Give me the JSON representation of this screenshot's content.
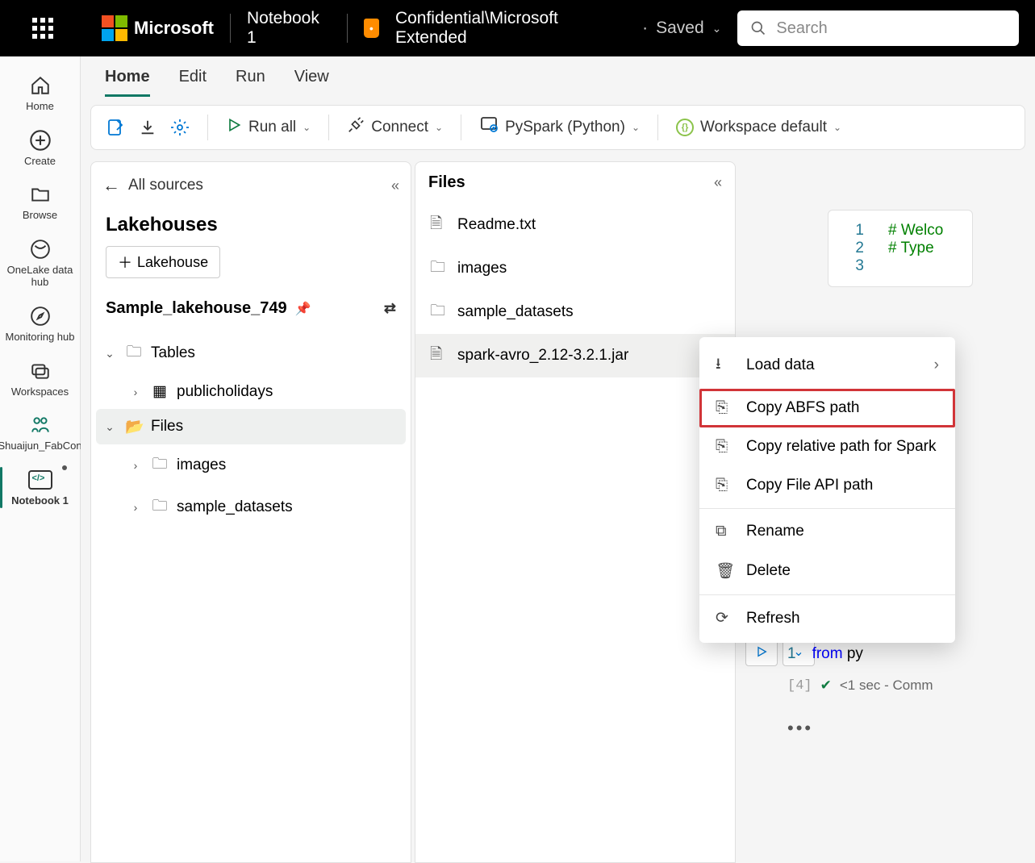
{
  "topbar": {
    "brand": "Microsoft",
    "notebook": "Notebook 1",
    "confidential": "Confidential\\Microsoft Extended",
    "saved": "Saved"
  },
  "search": {
    "placeholder": "Search"
  },
  "rail": {
    "home": "Home",
    "create": "Create",
    "browse": "Browse",
    "datahub": "OneLake data hub",
    "monitor": "Monitoring hub",
    "workspaces": "Workspaces",
    "ws_name": "Shuaijun_FabCon",
    "nb": "Notebook 1"
  },
  "tabs": {
    "home": "Home",
    "edit": "Edit",
    "run": "Run",
    "view": "View"
  },
  "toolbar": {
    "run_all": "Run all",
    "connect": "Connect",
    "language": "PySpark (Python)",
    "env": "Workspace default"
  },
  "panel1": {
    "all_sources": "All sources",
    "title": "Lakehouses",
    "add_btn": "Lakehouse",
    "lakehouse": "Sample_lakehouse_749",
    "tables": "Tables",
    "table1": "publicholidays",
    "files": "Files",
    "folder1": "images",
    "folder2": "sample_datasets"
  },
  "panel2": {
    "title": "Files",
    "items": [
      "Readme.txt",
      "images",
      "sample_datasets",
      "spark-avro_2.12-3.2.1.jar"
    ]
  },
  "ctx": {
    "load": "Load data",
    "abfs": "Copy ABFS path",
    "rel": "Copy relative path for Spark",
    "api": "Copy File API path",
    "rename": "Rename",
    "delete": "Delete",
    "refresh": "Refresh"
  },
  "code": {
    "l1": "# Welco",
    "l2": "# Type",
    "line2_num": "2",
    "line3_num": "3",
    "from": "from",
    "rest": " py",
    "exec_counter": "[4]",
    "exec_time": "<1 sec",
    "exec_rest": " - Comm"
  }
}
